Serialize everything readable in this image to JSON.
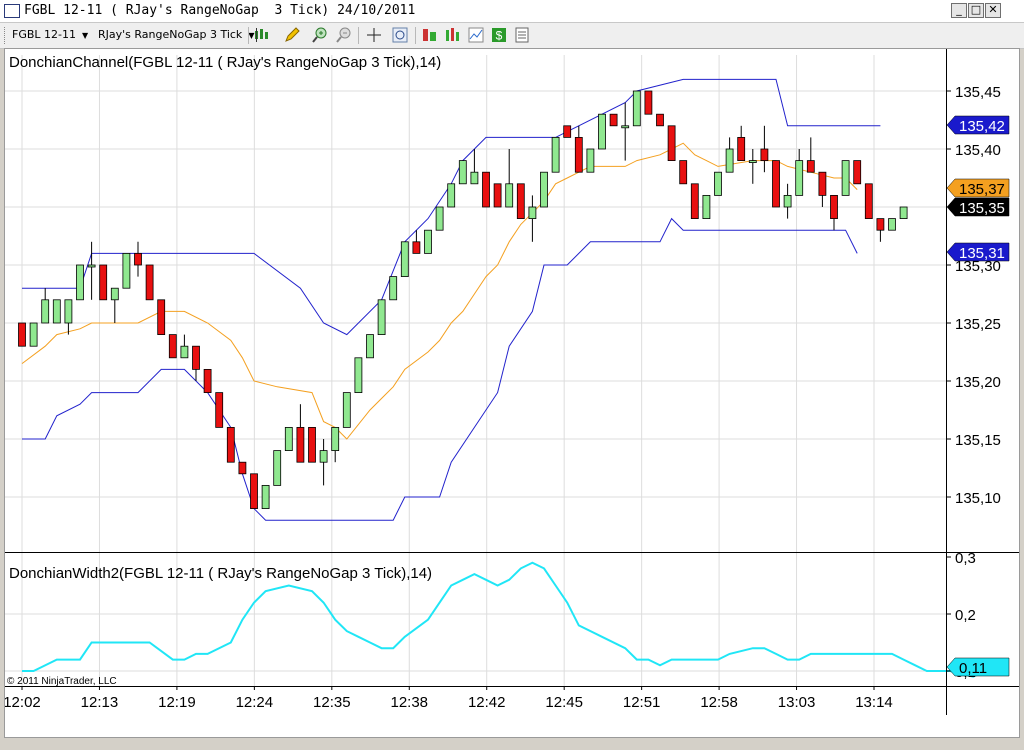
{
  "window": {
    "title": "FGBL 12-11 ( RJay's RangeNoGap  3 Tick) 24/10/2011",
    "buttons": {
      "minimize": "_",
      "maximize": "□",
      "close": "✕"
    }
  },
  "toolbar": {
    "instrument": "FGBL 12-11",
    "period": "RJay's RangeNoGap  3 Tick",
    "icons": [
      "candlestick-style-icon",
      "draw-pencil-icon",
      "zoom-in-icon",
      "zoom-out-icon",
      "crosshair-icon",
      "magnifier-icon",
      "strategies-icon",
      "indicators-icon",
      "chart-properties-icon",
      "dollar-icon",
      "data-box-icon"
    ]
  },
  "colors": {
    "up_candle": "#90e890",
    "down_candle": "#e81010",
    "donchian_band": "#2222cc",
    "donchian_mid": "#f4a020",
    "width_line": "#20e6f6",
    "last_price_label": "#000000",
    "upper_label": "#1a1acc",
    "mid_label": "#f4a020",
    "width_label": "#20e6f6"
  },
  "chart_data": [
    {
      "type": "candlestick",
      "title": "DonchianChannel(FGBL 12-11 ( RJay's RangeNoGap  3 Tick),14)",
      "tick_size": 0.01,
      "ylim": [
        135.065,
        135.475
      ],
      "yticks": [
        "135,10",
        "135,15",
        "135,20",
        "135,25",
        "135,30",
        "135,35",
        "135,40",
        "135,45"
      ],
      "x_labels": [
        "12:02",
        "12:13",
        "12:19",
        "12:24",
        "12:35",
        "12:38",
        "12:42",
        "12:45",
        "12:51",
        "12:58",
        "13:03",
        "13:14"
      ],
      "candles": [
        {
          "o": 135.25,
          "h": 135.25,
          "l": 135.23,
          "c": 135.23
        },
        {
          "o": 135.23,
          "h": 135.25,
          "l": 135.23,
          "c": 135.25
        },
        {
          "o": 135.25,
          "h": 135.28,
          "l": 135.25,
          "c": 135.27
        },
        {
          "o": 135.25,
          "h": 135.27,
          "l": 135.25,
          "c": 135.27
        },
        {
          "o": 135.25,
          "h": 135.27,
          "l": 135.24,
          "c": 135.27
        },
        {
          "o": 135.27,
          "h": 135.3,
          "l": 135.27,
          "c": 135.3
        },
        {
          "o": 135.3,
          "h": 135.32,
          "l": 135.27,
          "c": 135.3
        },
        {
          "o": 135.3,
          "h": 135.3,
          "l": 135.27,
          "c": 135.27
        },
        {
          "o": 135.27,
          "h": 135.28,
          "l": 135.25,
          "c": 135.28
        },
        {
          "o": 135.28,
          "h": 135.31,
          "l": 135.28,
          "c": 135.31
        },
        {
          "o": 135.31,
          "h": 135.32,
          "l": 135.29,
          "c": 135.3
        },
        {
          "o": 135.3,
          "h": 135.3,
          "l": 135.27,
          "c": 135.27
        },
        {
          "o": 135.27,
          "h": 135.27,
          "l": 135.24,
          "c": 135.24
        },
        {
          "o": 135.24,
          "h": 135.24,
          "l": 135.22,
          "c": 135.22
        },
        {
          "o": 135.22,
          "h": 135.24,
          "l": 135.22,
          "c": 135.23
        },
        {
          "o": 135.23,
          "h": 135.23,
          "l": 135.2,
          "c": 135.21
        },
        {
          "o": 135.21,
          "h": 135.21,
          "l": 135.19,
          "c": 135.19
        },
        {
          "o": 135.19,
          "h": 135.19,
          "l": 135.16,
          "c": 135.16
        },
        {
          "o": 135.16,
          "h": 135.16,
          "l": 135.13,
          "c": 135.13
        },
        {
          "o": 135.13,
          "h": 135.13,
          "l": 135.12,
          "c": 135.12
        },
        {
          "o": 135.12,
          "h": 135.12,
          "l": 135.09,
          "c": 135.09
        },
        {
          "o": 135.09,
          "h": 135.11,
          "l": 135.09,
          "c": 135.11
        },
        {
          "o": 135.11,
          "h": 135.14,
          "l": 135.11,
          "c": 135.14
        },
        {
          "o": 135.14,
          "h": 135.16,
          "l": 135.14,
          "c": 135.16
        },
        {
          "o": 135.16,
          "h": 135.18,
          "l": 135.13,
          "c": 135.13
        },
        {
          "o": 135.16,
          "h": 135.16,
          "l": 135.13,
          "c": 135.13
        },
        {
          "o": 135.13,
          "h": 135.15,
          "l": 135.11,
          "c": 135.14
        },
        {
          "o": 135.14,
          "h": 135.16,
          "l": 135.13,
          "c": 135.16
        },
        {
          "o": 135.16,
          "h": 135.19,
          "l": 135.16,
          "c": 135.19
        },
        {
          "o": 135.19,
          "h": 135.22,
          "l": 135.19,
          "c": 135.22
        },
        {
          "o": 135.22,
          "h": 135.24,
          "l": 135.22,
          "c": 135.24
        },
        {
          "o": 135.24,
          "h": 135.27,
          "l": 135.24,
          "c": 135.27
        },
        {
          "o": 135.27,
          "h": 135.29,
          "l": 135.27,
          "c": 135.29
        },
        {
          "o": 135.29,
          "h": 135.32,
          "l": 135.29,
          "c": 135.32
        },
        {
          "o": 135.32,
          "h": 135.33,
          "l": 135.31,
          "c": 135.31
        },
        {
          "o": 135.31,
          "h": 135.33,
          "l": 135.31,
          "c": 135.33
        },
        {
          "o": 135.33,
          "h": 135.35,
          "l": 135.33,
          "c": 135.35
        },
        {
          "o": 135.35,
          "h": 135.37,
          "l": 135.35,
          "c": 135.37
        },
        {
          "o": 135.37,
          "h": 135.39,
          "l": 135.37,
          "c": 135.39
        },
        {
          "o": 135.37,
          "h": 135.4,
          "l": 135.37,
          "c": 135.38
        },
        {
          "o": 135.38,
          "h": 135.38,
          "l": 135.35,
          "c": 135.35
        },
        {
          "o": 135.37,
          "h": 135.37,
          "l": 135.35,
          "c": 135.35
        },
        {
          "o": 135.35,
          "h": 135.4,
          "l": 135.35,
          "c": 135.37
        },
        {
          "o": 135.37,
          "h": 135.37,
          "l": 135.34,
          "c": 135.34
        },
        {
          "o": 135.34,
          "h": 135.36,
          "l": 135.32,
          "c": 135.35
        },
        {
          "o": 135.35,
          "h": 135.38,
          "l": 135.35,
          "c": 135.38
        },
        {
          "o": 135.38,
          "h": 135.41,
          "l": 135.38,
          "c": 135.41
        },
        {
          "o": 135.42,
          "h": 135.42,
          "l": 135.41,
          "c": 135.41
        },
        {
          "o": 135.41,
          "h": 135.42,
          "l": 135.38,
          "c": 135.38
        },
        {
          "o": 135.38,
          "h": 135.4,
          "l": 135.38,
          "c": 135.4
        },
        {
          "o": 135.4,
          "h": 135.43,
          "l": 135.4,
          "c": 135.43
        },
        {
          "o": 135.43,
          "h": 135.43,
          "l": 135.42,
          "c": 135.42
        },
        {
          "o": 135.42,
          "h": 135.44,
          "l": 135.39,
          "c": 135.42
        },
        {
          "o": 135.42,
          "h": 135.45,
          "l": 135.42,
          "c": 135.45
        },
        {
          "o": 135.45,
          "h": 135.45,
          "l": 135.43,
          "c": 135.43
        },
        {
          "o": 135.43,
          "h": 135.43,
          "l": 135.42,
          "c": 135.42
        },
        {
          "o": 135.42,
          "h": 135.42,
          "l": 135.39,
          "c": 135.39
        },
        {
          "o": 135.39,
          "h": 135.39,
          "l": 135.37,
          "c": 135.37
        },
        {
          "o": 135.37,
          "h": 135.37,
          "l": 135.34,
          "c": 135.34
        },
        {
          "o": 135.34,
          "h": 135.36,
          "l": 135.34,
          "c": 135.36
        },
        {
          "o": 135.36,
          "h": 135.38,
          "l": 135.36,
          "c": 135.38
        },
        {
          "o": 135.38,
          "h": 135.41,
          "l": 135.38,
          "c": 135.4
        },
        {
          "o": 135.41,
          "h": 135.42,
          "l": 135.39,
          "c": 135.39
        },
        {
          "o": 135.39,
          "h": 135.4,
          "l": 135.37,
          "c": 135.39
        },
        {
          "o": 135.4,
          "h": 135.42,
          "l": 135.38,
          "c": 135.39
        },
        {
          "o": 135.39,
          "h": 135.39,
          "l": 135.35,
          "c": 135.35
        },
        {
          "o": 135.35,
          "h": 135.37,
          "l": 135.34,
          "c": 135.36
        },
        {
          "o": 135.36,
          "h": 135.4,
          "l": 135.36,
          "c": 135.39
        },
        {
          "o": 135.39,
          "h": 135.41,
          "l": 135.38,
          "c": 135.38
        },
        {
          "o": 135.38,
          "h": 135.38,
          "l": 135.35,
          "c": 135.36
        },
        {
          "o": 135.36,
          "h": 135.36,
          "l": 135.33,
          "c": 135.34
        },
        {
          "o": 135.36,
          "h": 135.37,
          "l": 135.39,
          "c": 135.39
        },
        {
          "o": 135.39,
          "h": 135.39,
          "l": 135.37,
          "c": 135.37
        },
        {
          "o": 135.37,
          "h": 135.37,
          "l": 135.34,
          "c": 135.34
        },
        {
          "o": 135.34,
          "h": 135.34,
          "l": 135.32,
          "c": 135.33
        },
        {
          "o": 135.33,
          "h": 135.34,
          "l": 135.33,
          "c": 135.34
        },
        {
          "o": 135.34,
          "h": 135.35,
          "l": 135.34,
          "c": 135.35
        }
      ],
      "upper_band": [
        [
          0,
          135.28
        ],
        [
          5,
          135.28
        ],
        [
          6,
          135.31
        ],
        [
          10,
          135.31
        ],
        [
          15,
          135.31
        ],
        [
          20,
          135.31
        ],
        [
          24,
          135.28
        ],
        [
          26,
          135.25
        ],
        [
          28,
          135.24
        ],
        [
          31,
          135.27
        ],
        [
          33,
          135.32
        ],
        [
          35,
          135.34
        ],
        [
          37,
          135.37
        ],
        [
          38,
          135.39
        ],
        [
          40,
          135.41
        ],
        [
          46,
          135.41
        ],
        [
          48,
          135.42
        ],
        [
          52,
          135.44
        ],
        [
          53,
          135.45
        ],
        [
          57,
          135.46
        ],
        [
          60,
          135.46
        ],
        [
          63,
          135.46
        ],
        [
          65,
          135.46
        ],
        [
          66,
          135.42
        ],
        [
          73,
          135.42
        ],
        [
          74,
          135.42
        ]
      ],
      "lower_band": [
        [
          0,
          135.15
        ],
        [
          2,
          135.15
        ],
        [
          3,
          135.17
        ],
        [
          5,
          135.18
        ],
        [
          6,
          135.19
        ],
        [
          10,
          135.19
        ],
        [
          12,
          135.21
        ],
        [
          14,
          135.21
        ],
        [
          16,
          135.19
        ],
        [
          18,
          135.16
        ],
        [
          19,
          135.12
        ],
        [
          20,
          135.09
        ],
        [
          21,
          135.08
        ],
        [
          25,
          135.08
        ],
        [
          30,
          135.08
        ],
        [
          32,
          135.08
        ],
        [
          33,
          135.1
        ],
        [
          36,
          135.1
        ],
        [
          37,
          135.13
        ],
        [
          39,
          135.16
        ],
        [
          41,
          135.19
        ],
        [
          42,
          135.23
        ],
        [
          44,
          135.26
        ],
        [
          45,
          135.3
        ],
        [
          47,
          135.3
        ],
        [
          49,
          135.32
        ],
        [
          55,
          135.32
        ],
        [
          56,
          135.34
        ],
        [
          57,
          135.33
        ],
        [
          59,
          135.33
        ],
        [
          63,
          135.33
        ],
        [
          66,
          135.33
        ],
        [
          68,
          135.33
        ],
        [
          70,
          135.33
        ],
        [
          71,
          135.33
        ],
        [
          72,
          135.31
        ]
      ],
      "middle_line": [
        [
          0,
          135.215
        ],
        [
          2,
          135.23
        ],
        [
          3,
          135.24
        ],
        [
          5,
          135.245
        ],
        [
          6,
          135.25
        ],
        [
          10,
          135.25
        ],
        [
          12,
          135.26
        ],
        [
          14,
          135.26
        ],
        [
          16,
          135.25
        ],
        [
          18,
          135.235
        ],
        [
          19,
          135.22
        ],
        [
          20,
          135.2
        ],
        [
          22,
          135.195
        ],
        [
          25,
          135.19
        ],
        [
          26,
          135.165
        ],
        [
          27,
          135.16
        ],
        [
          28,
          135.15
        ],
        [
          30,
          135.175
        ],
        [
          32,
          135.195
        ],
        [
          33,
          135.21
        ],
        [
          35,
          135.225
        ],
        [
          36,
          135.235
        ],
        [
          37,
          135.25
        ],
        [
          38,
          135.26
        ],
        [
          39,
          135.275
        ],
        [
          40,
          135.29
        ],
        [
          41,
          135.3
        ],
        [
          42,
          135.32
        ],
        [
          43,
          135.335
        ],
        [
          44,
          135.345
        ],
        [
          45,
          135.355
        ],
        [
          46,
          135.37
        ],
        [
          47,
          135.375
        ],
        [
          48,
          135.38
        ],
        [
          49,
          135.385
        ],
        [
          52,
          135.385
        ],
        [
          53,
          135.39
        ],
        [
          55,
          135.395
        ],
        [
          56,
          135.4
        ],
        [
          57,
          135.405
        ],
        [
          58,
          135.395
        ],
        [
          59,
          135.39
        ],
        [
          60,
          135.385
        ],
        [
          63,
          135.39
        ],
        [
          65,
          135.39
        ],
        [
          66,
          135.385
        ],
        [
          68,
          135.38
        ],
        [
          70,
          135.375
        ],
        [
          71,
          135.375
        ],
        [
          72,
          135.365
        ]
      ],
      "last_price": "135,35",
      "upper_label": "135,42",
      "mid_label": "135,37",
      "lower_label": "135,31"
    },
    {
      "type": "line",
      "title": "DonchianWidth2(FGBL 12-11 ( RJay's RangeNoGap  3 Tick),14)",
      "ylim": [
        0.07,
        0.31
      ],
      "yticks": [
        "0,3",
        "0,2",
        "0,1"
      ],
      "values": [
        [
          0,
          0.1
        ],
        [
          1,
          0.1
        ],
        [
          3,
          0.12
        ],
        [
          5,
          0.12
        ],
        [
          6,
          0.15
        ],
        [
          11,
          0.15
        ],
        [
          13,
          0.12
        ],
        [
          14,
          0.12
        ],
        [
          15,
          0.13
        ],
        [
          16,
          0.13
        ],
        [
          18,
          0.15
        ],
        [
          19,
          0.19
        ],
        [
          20,
          0.22
        ],
        [
          21,
          0.24
        ],
        [
          23,
          0.25
        ],
        [
          25,
          0.24
        ],
        [
          26,
          0.22
        ],
        [
          27,
          0.19
        ],
        [
          28,
          0.17
        ],
        [
          29,
          0.16
        ],
        [
          30,
          0.15
        ],
        [
          31,
          0.14
        ],
        [
          32,
          0.14
        ],
        [
          33,
          0.16
        ],
        [
          35,
          0.19
        ],
        [
          36,
          0.22
        ],
        [
          37,
          0.25
        ],
        [
          38,
          0.26
        ],
        [
          39,
          0.27
        ],
        [
          40,
          0.26
        ],
        [
          41,
          0.25
        ],
        [
          42,
          0.26
        ],
        [
          43,
          0.28
        ],
        [
          44,
          0.29
        ],
        [
          45,
          0.28
        ],
        [
          46,
          0.25
        ],
        [
          47,
          0.22
        ],
        [
          48,
          0.18
        ],
        [
          50,
          0.16
        ],
        [
          52,
          0.14
        ],
        [
          53,
          0.12
        ],
        [
          54,
          0.12
        ],
        [
          55,
          0.11
        ],
        [
          56,
          0.12
        ],
        [
          57,
          0.12
        ],
        [
          60,
          0.12
        ],
        [
          61,
          0.13
        ],
        [
          63,
          0.14
        ],
        [
          64,
          0.14
        ],
        [
          65,
          0.13
        ],
        [
          66,
          0.12
        ],
        [
          67,
          0.12
        ],
        [
          68,
          0.13
        ],
        [
          70,
          0.13
        ],
        [
          71,
          0.13
        ],
        [
          72,
          0.13
        ],
        [
          73,
          0.13
        ],
        [
          75,
          0.13
        ],
        [
          76,
          0.12
        ],
        [
          77,
          0.11
        ],
        [
          78,
          0.1
        ],
        [
          80,
          0.1
        ],
        [
          82,
          0.09
        ],
        [
          83,
          0.1
        ]
      ],
      "last_label": "0,11"
    }
  ],
  "copyright": "© 2011 NinjaTrader, LLC"
}
